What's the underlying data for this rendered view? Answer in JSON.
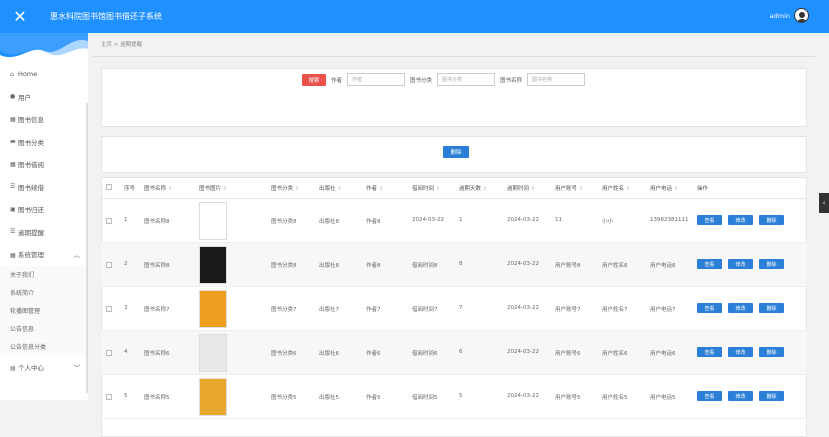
{
  "topbar": {
    "close_icon": "close-icon",
    "title": "惠水科院图书馆图书借还子系统",
    "user": "admin"
  },
  "sidebar": {
    "items": [
      {
        "label": "Home",
        "icon": "home-icon",
        "glyph": "⌂"
      },
      {
        "label": "用户",
        "icon": "user-icon",
        "glyph": "👤"
      },
      {
        "label": "图书信息",
        "icon": "grid-icon",
        "glyph": "▦"
      },
      {
        "label": "图书分类",
        "icon": "book-icon",
        "glyph": "▬"
      },
      {
        "label": "图书借阅",
        "icon": "grid-icon",
        "glyph": "▦"
      },
      {
        "label": "图书续借",
        "icon": "list-icon",
        "glyph": "☰"
      },
      {
        "label": "图书归还",
        "icon": "calendar-icon",
        "glyph": "▣"
      },
      {
        "label": "逾期提醒",
        "icon": "list-icon",
        "glyph": "☰"
      },
      {
        "label": "系统管理",
        "icon": "grid-icon",
        "glyph": "▦"
      }
    ],
    "sub_items": [
      "关于我们",
      "系统简介",
      "轮播图管理",
      "公告信息",
      "公告信息分类"
    ],
    "bottom_item": "个人中心"
  },
  "breadcrumb": "主页 > 逾期提醒",
  "search": {
    "button": "搜索",
    "fields": [
      {
        "label": "作者",
        "placeholder": "作者"
      },
      {
        "label": "图书分类",
        "placeholder": "图书分类"
      },
      {
        "label": "图书名称",
        "placeholder": "图书名称"
      }
    ]
  },
  "actions": {
    "delete": "删除"
  },
  "table": {
    "headers": [
      "序号",
      "图书名称",
      "图书图片",
      "图书分类",
      "出版社",
      "作者",
      "借阅时间",
      "逾期天数",
      "逾期时间",
      "用户账号",
      "用户姓名",
      "用户电话",
      "操作"
    ],
    "row_buttons": {
      "view": "查看",
      "edit": "修改",
      "delete": "删除"
    },
    "rows": [
      {
        "no": "1",
        "name": "图书名称8",
        "category": "图书分类8",
        "publisher": "出版社8",
        "author": "作者8",
        "borrow_time": "2024-03-22",
        "overdue_days": "1",
        "overdue_time": "2024-03-22",
        "account": "11",
        "user_name": "小小",
        "phone": "13982381111",
        "cover": "#ffffff"
      },
      {
        "no": "2",
        "name": "图书名称8",
        "category": "图书分类8",
        "publisher": "出版社8",
        "author": "作者8",
        "borrow_time": "借阅时间8",
        "overdue_days": "8",
        "overdue_time": "2024-03-22",
        "account": "用户账号8",
        "user_name": "用户姓名8",
        "phone": "用户电话8",
        "cover": "#1a1a1a"
      },
      {
        "no": "3",
        "name": "图书名称7",
        "category": "图书分类7",
        "publisher": "出版社7",
        "author": "作者7",
        "borrow_time": "借阅时间7",
        "overdue_days": "7",
        "overdue_time": "2024-03-22",
        "account": "用户账号7",
        "user_name": "用户姓名7",
        "phone": "用户电话7",
        "cover": "#f0a020"
      },
      {
        "no": "4",
        "name": "图书名称6",
        "category": "图书分类6",
        "publisher": "出版社6",
        "author": "作者6",
        "borrow_time": "借阅时间6",
        "overdue_days": "6",
        "overdue_time": "2024-03-22",
        "account": "用户账号6",
        "user_name": "用户姓名6",
        "phone": "用户电话6",
        "cover": "#e8e8e8"
      },
      {
        "no": "5",
        "name": "图书名称5",
        "category": "图书分类5",
        "publisher": "出版社5",
        "author": "作者5",
        "borrow_time": "借阅时间5",
        "overdue_days": "5",
        "overdue_time": "2024-03-22",
        "account": "用户账号5",
        "user_name": "用户姓名5",
        "phone": "用户电话5",
        "cover": "#e8a830"
      }
    ]
  },
  "colors": {
    "topbar": "#1e90ff",
    "primary_button": "#2b7fd6",
    "search_button": "#e9524a"
  }
}
